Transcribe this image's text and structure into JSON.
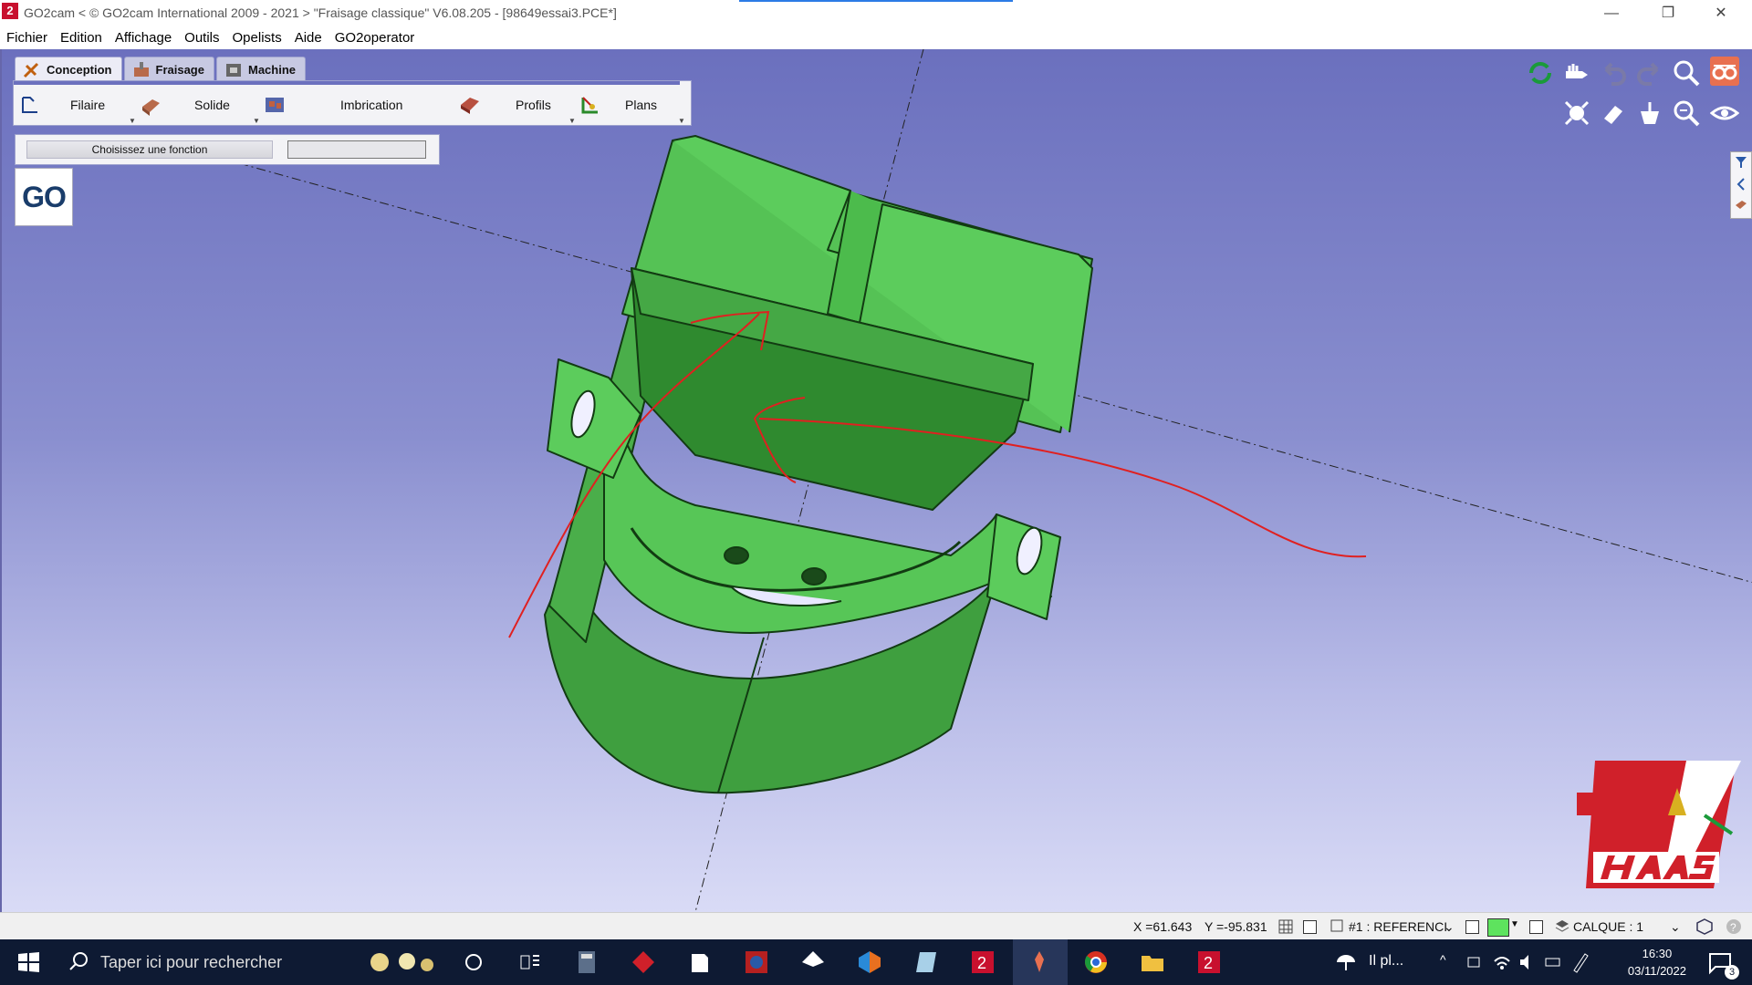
{
  "title_bar": {
    "app_icon": "2",
    "text": "GO2cam < © GO2cam International 2009 - 2021 >     \"Fraisage classique\"   V6.08.205 - [98649essai3.PCE*]",
    "minimize": "—",
    "restore": "❐",
    "close": "✕"
  },
  "menu": [
    "Fichier",
    "Edition",
    "Affichage",
    "Outils",
    "Opelists",
    "Aide",
    "GO2operator"
  ],
  "tabs": [
    {
      "label": "Conception",
      "icon": "conception-icon"
    },
    {
      "label": "Fraisage",
      "icon": "fraisage-icon"
    },
    {
      "label": "Machine",
      "icon": "machine-icon"
    }
  ],
  "tools": [
    {
      "label": "Filaire",
      "icon": "wireframe-icon"
    },
    {
      "label": "Solide",
      "icon": "solid-icon"
    },
    {
      "label": "Imbrication",
      "icon": "nesting-icon"
    },
    {
      "label": "Profils",
      "icon": "profiles-icon"
    },
    {
      "label": "Plans",
      "icon": "planes-icon"
    }
  ],
  "function_prompt": "Choisissez une fonction",
  "go_button": "GO",
  "brand_logo": "HAAS",
  "status": {
    "x": "X =61.643",
    "y": "Y =-95.831",
    "reference": "#1 : REFERENCI",
    "layer": "CALQUE :  1"
  },
  "taskbar": {
    "search_placeholder": "Taper ici pour rechercher",
    "weather": "Il pl...",
    "time": "16:30",
    "date": "03/11/2022",
    "notifications": "3"
  },
  "colors": {
    "viewport_top": "#6b70be",
    "viewport_bottom": "#d9dbf6",
    "part_green": "#4cbb4c",
    "annotation_red": "#e02020",
    "haas_red": "#d0202a"
  }
}
